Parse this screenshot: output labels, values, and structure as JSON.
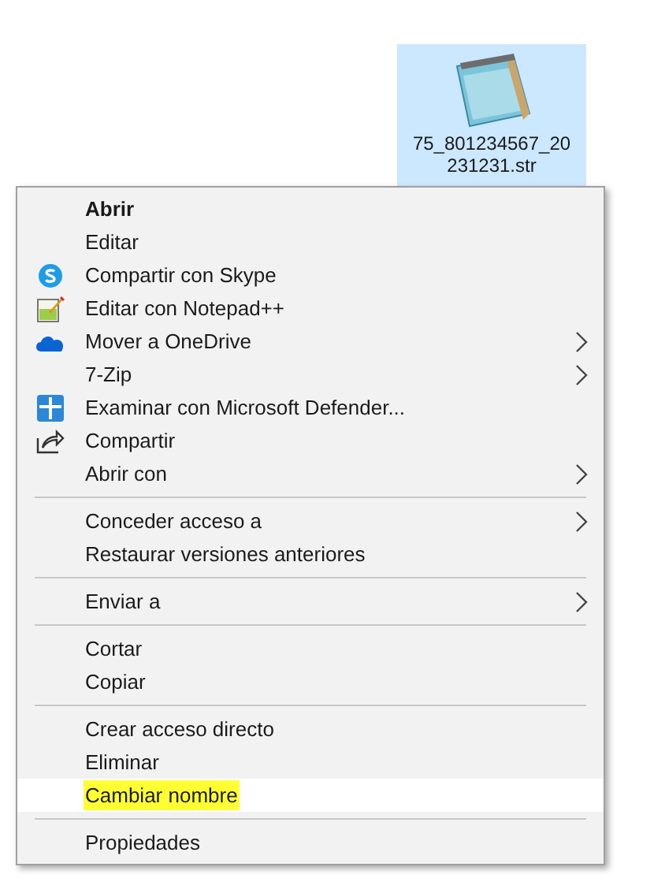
{
  "desktop_file": {
    "name_lines": [
      "75_801234567_20",
      "231231.str"
    ],
    "selected": true
  },
  "context_menu": {
    "groups": [
      {
        "items": [
          {
            "label": "Abrir",
            "default": true,
            "submenu": false,
            "selected": false
          },
          {
            "label": "Editar",
            "default": false,
            "submenu": false,
            "selected": false
          },
          {
            "label": "Compartir con Skype",
            "default": false,
            "submenu": false,
            "selected": false
          },
          {
            "label": "Editar con Notepad++",
            "default": false,
            "submenu": false,
            "selected": false
          },
          {
            "label": "Mover a OneDrive",
            "default": false,
            "submenu": true,
            "selected": false
          },
          {
            "label": "7-Zip",
            "default": false,
            "submenu": true,
            "selected": false
          },
          {
            "label": "Examinar con Microsoft Defender...",
            "default": false,
            "submenu": false,
            "selected": false
          },
          {
            "label": "Compartir",
            "default": false,
            "submenu": false,
            "selected": false
          },
          {
            "label": "Abrir con",
            "default": false,
            "submenu": true,
            "selected": false
          }
        ]
      },
      {
        "items": [
          {
            "label": "Conceder acceso a",
            "default": false,
            "submenu": true,
            "selected": false
          },
          {
            "label": "Restaurar versiones anteriores",
            "default": false,
            "submenu": false,
            "selected": false
          }
        ]
      },
      {
        "items": [
          {
            "label": "Enviar a",
            "default": false,
            "submenu": true,
            "selected": false
          }
        ]
      },
      {
        "items": [
          {
            "label": "Cortar",
            "default": false,
            "submenu": false,
            "selected": false
          },
          {
            "label": "Copiar",
            "default": false,
            "submenu": false,
            "selected": false
          }
        ]
      },
      {
        "items": [
          {
            "label": "Crear acceso directo",
            "default": false,
            "submenu": false,
            "selected": false
          },
          {
            "label": "Eliminar",
            "default": false,
            "submenu": false,
            "selected": false
          },
          {
            "label": "Cambiar nombre",
            "default": false,
            "submenu": false,
            "selected": true
          }
        ]
      },
      {
        "items": [
          {
            "label": "Propiedades",
            "default": false,
            "submenu": false,
            "selected": false
          }
        ]
      }
    ]
  }
}
